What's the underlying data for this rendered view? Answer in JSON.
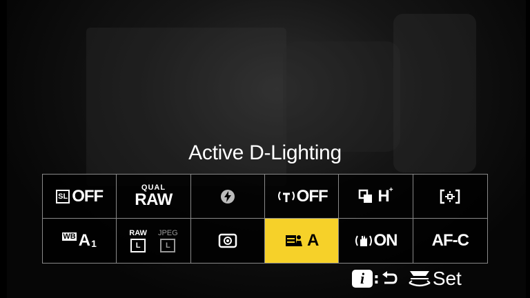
{
  "title": "Active D-Lighting",
  "grid": {
    "row1": {
      "picture_control": {
        "tag": "SL",
        "value": "OFF"
      },
      "image_quality": {
        "small": "QUAL",
        "big": "RAW"
      },
      "flash_icon": "flash-mode-icon",
      "wireless": {
        "value": "OFF"
      },
      "release_mode": {
        "value": "H",
        "sup": "+"
      },
      "af_area_icon": "af-area-mode-icon"
    },
    "row2": {
      "white_balance": {
        "tag": "WB",
        "value": "A",
        "sub": "1"
      },
      "image_size": {
        "raw_label": "RAW",
        "raw_size": "L",
        "jpeg_label": "JPEG",
        "jpeg_size": "L"
      },
      "metering_icon": "metering-icon",
      "active_d_lighting": {
        "value": "A"
      },
      "vibration_reduction": {
        "value": "ON"
      },
      "focus_mode": "AF-C"
    }
  },
  "footer": {
    "info_key": "i",
    "set_label": "Set"
  },
  "colors": {
    "selected": "#f6d129",
    "grid_border": "#8a8a8a",
    "background": "#000000"
  }
}
